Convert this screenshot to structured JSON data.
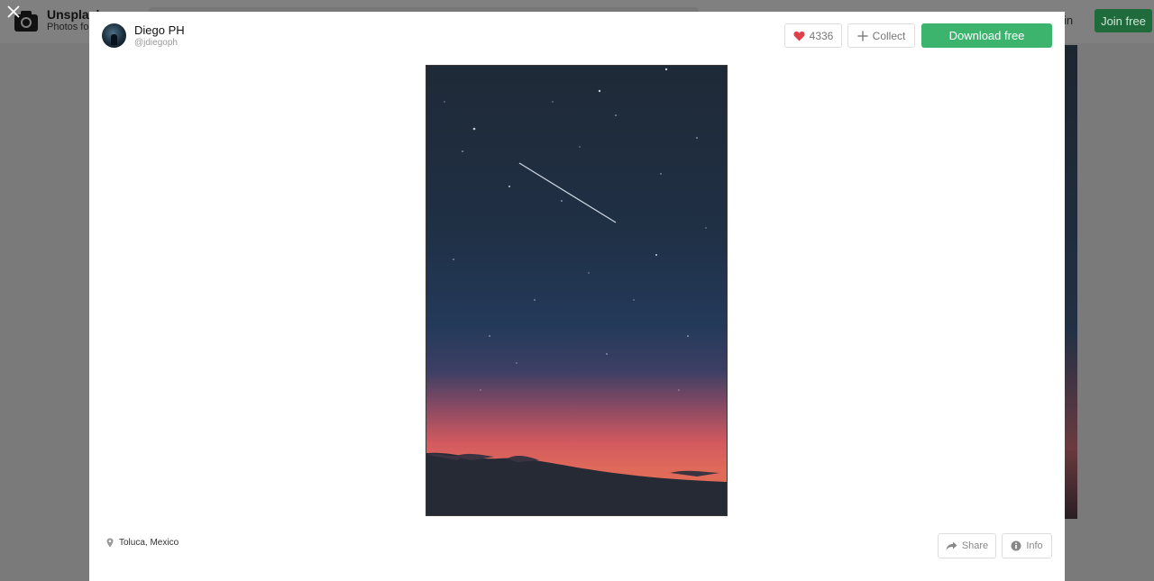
{
  "background": {
    "brand": "Unsplash",
    "tagline": "Photos fo",
    "login_label": "in",
    "join_label": "Join free",
    "icons": {
      "logo": "camera-icon",
      "close": "close-icon"
    }
  },
  "modal": {
    "user": {
      "name": "Diego PH",
      "handle": "@jdiegoph"
    },
    "actions": {
      "like_count": "4336",
      "collect_label": "Collect",
      "download_label": "Download free",
      "like_color": "#e0404a",
      "download_color": "#3cb46e"
    },
    "footer": {
      "location": "Toluca, Mexico",
      "share_label": "Share",
      "info_label": "Info"
    },
    "icons": {
      "like": "heart-icon",
      "collect": "plus-icon",
      "location": "map-pin-icon",
      "share": "share-arrow-icon",
      "info": "info-icon"
    }
  }
}
